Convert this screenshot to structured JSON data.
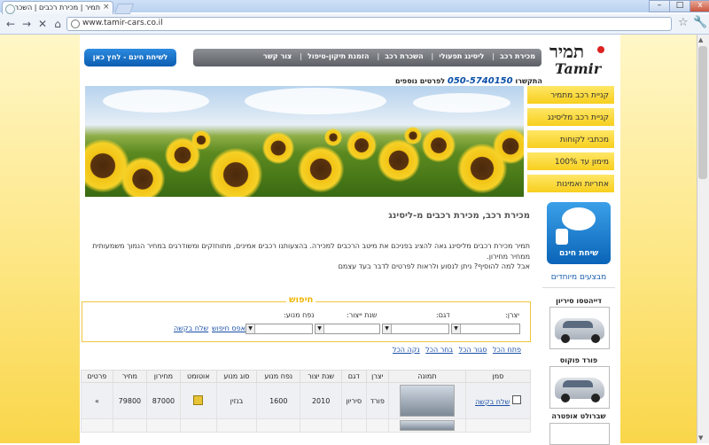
{
  "browser": {
    "tab_title": "תמיר | מכירת רכבים | השכרה",
    "tab_close": "×",
    "url": "www.tamir-cars.co.il",
    "win_min": "–",
    "win_max": "□",
    "win_close": "x"
  },
  "site": {
    "logo_top": "תמיר",
    "logo_bottom": "Tamir",
    "nav": [
      "מכירת רכב",
      "ליסינג תפעולי",
      "השכרת רכב",
      "הזמנת תיקון-טיפול",
      "צור קשר"
    ],
    "free_call_button": "לשיחת חינם - לחץ כאן",
    "contact_prefix": "התקשרו",
    "contact_phone": "050-5740150",
    "contact_suffix": "לפרטים נוספים"
  },
  "sidebar": [
    "קניית רכב מתמיר",
    "קניית רכב מליסינג",
    "מכתבי לקוחות",
    "מימון עד 100%",
    "אחריות ואמינות"
  ],
  "main": {
    "title": "מכירת רכב, מכירת רכבים מ-ליסינג",
    "body1": "תמיר מכירת רכבים מליסינג גאה להציג בפניכם את מיטב הרכבים למכירה. בהצעותנו רכבים אמינים, מתוחזקים ומשודרגים במחיר הנמוך משמעותית ממחיר מחירון.",
    "body2": "אבל למה להוסיף? ניתן לנסוע ולראות לפרטים לדבר בעד עצמם"
  },
  "callbox": {
    "label": "שיחת חינם"
  },
  "featured": {
    "label": "מבצעים מיוחדים",
    "cars": [
      "דייהטסו סיריון",
      "פורד פוקוס",
      "שברולט אופטרה"
    ]
  },
  "search": {
    "legend": "חיפוש",
    "labels": [
      "יצרן:",
      "דגם:",
      "שנת ייצור:",
      "נפח מנוע:"
    ],
    "reset": "אפס חיפוש",
    "send": "שלח בקשה"
  },
  "links": [
    "פתח הכל",
    "סגור הכל",
    "בחר הכל",
    "נקה הכל"
  ],
  "table": {
    "headers": [
      "סמן",
      "תמונה",
      "יצרן",
      "דגם",
      "שנת יצור",
      "נפח מנוע",
      "סוג מנוע",
      "אוטומט",
      "מחירון",
      "מחיר",
      "פרטים"
    ],
    "row": {
      "send": "שלח בקשה",
      "maker": "פורד",
      "model": "סיריון",
      "year": "2010",
      "engine": "1600",
      "fuel": "בנזין",
      "list_price": "87000",
      "price": "79800",
      "details": "»"
    }
  }
}
